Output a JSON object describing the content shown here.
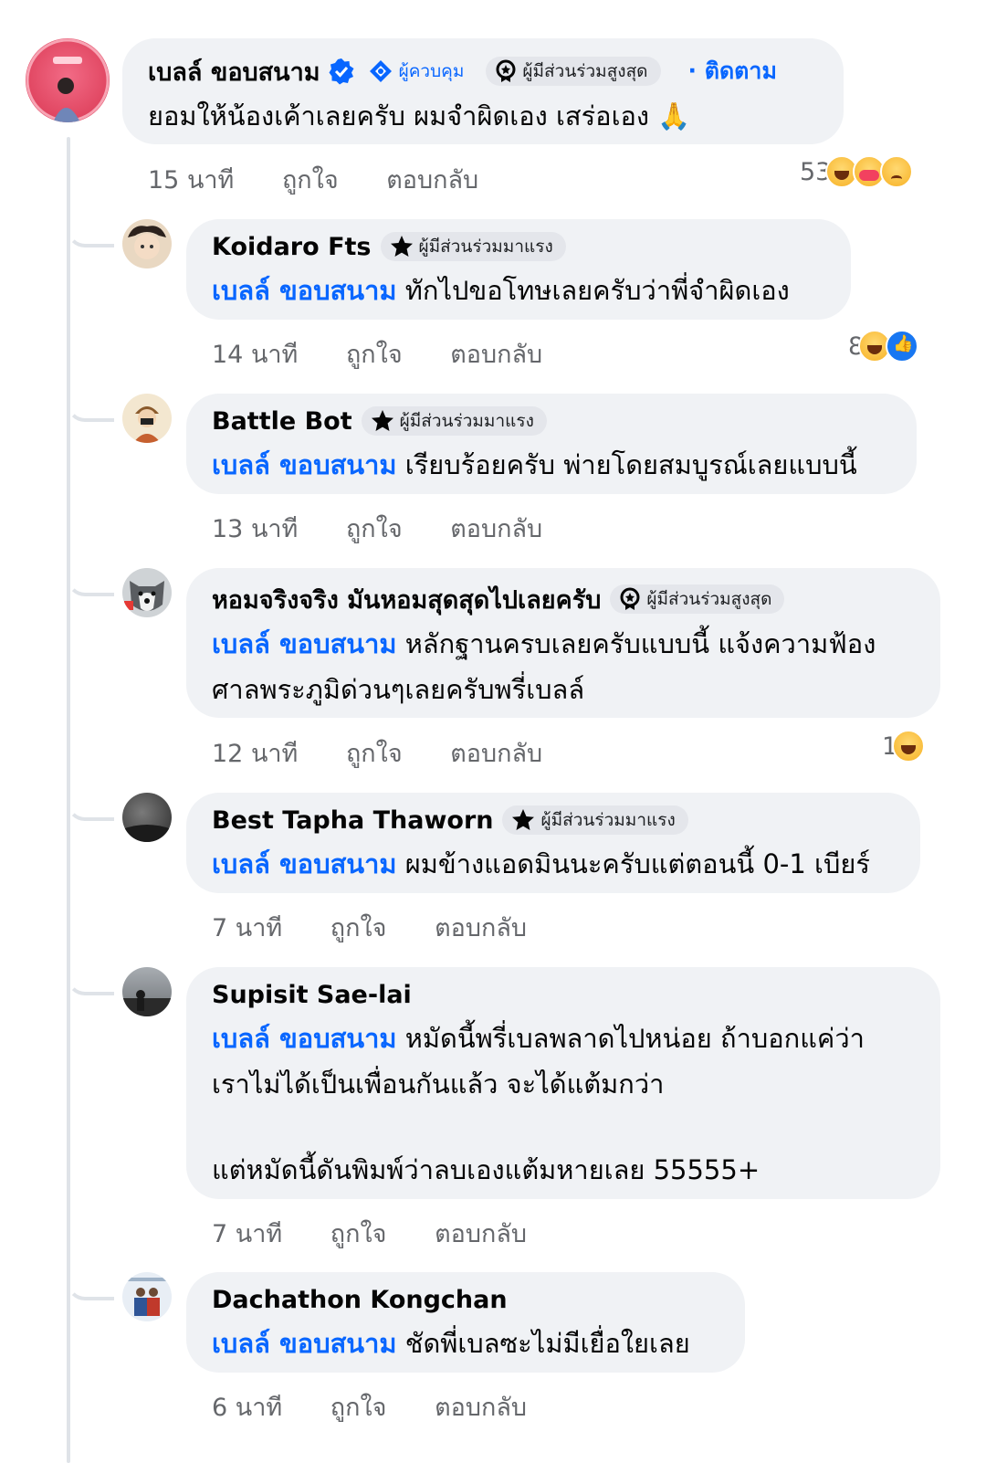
{
  "main_comment": {
    "author": "เบลล์ ขอบสนาม",
    "badge_admin": "ผู้ควบคุม",
    "badge_top": "ผู้มีส่วนร่วมสูงสุด",
    "follow": "· ติดตาม",
    "text": "ยอมให้น้องเค้าเลยครับ ผมจำผิดเอง เสร่อเอง",
    "emoji": "🙏",
    "time": "15 นาที",
    "like": "ถูกใจ",
    "reply": "ตอบกลับ",
    "reaction_count": "53",
    "reaction_icons": [
      "haha-icon",
      "care-icon",
      "sad-icon"
    ]
  },
  "replies": [
    {
      "author": "Koidaro Fts",
      "badge": "ผู้มีส่วนร่วมมาแรง",
      "badge_type": "rising",
      "mention": "เบลล์ ขอบสนาม",
      "lines": [
        "ทักไปขอโทษเลยครับว่าพี่จำผิดเอง"
      ],
      "time": "14 นาที",
      "like": "ถูกใจ",
      "reply": "ตอบกลับ",
      "reaction_count": "8",
      "reaction_icons": [
        "haha-icon",
        "like-icon"
      ]
    },
    {
      "author": "Battle Bot",
      "badge": "ผู้มีส่วนร่วมมาแรง",
      "badge_type": "rising",
      "mention": "เบลล์ ขอบสนาม",
      "lines": [
        "เรียบร้อยครับ พ่ายโดยสมบูรณ์เลยแบบนี้"
      ],
      "time": "13 นาที",
      "like": "ถูกใจ",
      "reply": "ตอบกลับ",
      "reaction_count": "",
      "reaction_icons": []
    },
    {
      "author": "หอมจริงจริง มันหอมสุดสุดไปเลยครับ",
      "badge": "ผู้มีส่วนร่วมสูงสุด",
      "badge_type": "top",
      "mention": "เบลล์ ขอบสนาม",
      "lines": [
        "หลักฐานครบเลยครับแบบนี้ แจ้งความฟ้อง",
        "ศาลพระภูมิด่วนๆเลยครับพรี่เบลล์"
      ],
      "time": "12 นาที",
      "like": "ถูกใจ",
      "reply": "ตอบกลับ",
      "reaction_count": "1",
      "reaction_icons": [
        "haha-icon"
      ]
    },
    {
      "author": "Best Tapha Thaworn",
      "badge": "ผู้มีส่วนร่วมมาแรง",
      "badge_type": "rising",
      "mention": "เบลล์ ขอบสนาม",
      "lines": [
        "ผมข้างแอดมินนะครับแต่ตอนนี้  0-1 เบียร์"
      ],
      "time": "7 นาที",
      "like": "ถูกใจ",
      "reply": "ตอบกลับ",
      "reaction_count": "",
      "reaction_icons": []
    },
    {
      "author": "Supisit Sae-lai",
      "badge": "",
      "badge_type": "",
      "mention": "เบลล์ ขอบสนาม",
      "lines": [
        "หมัดนี้พรี่เบลพลาดไปหน่อย ถ้าบอกแค่ว่า",
        "เราไม่ได้เป็นเพื่อนกันแล้ว จะได้แต้มกว่า",
        "",
        "แต่หมัดนี้ดันพิมพ์ว่าลบเองแต้มหายเลย 55555+"
      ],
      "time": "7 นาที",
      "like": "ถูกใจ",
      "reply": "ตอบกลับ",
      "reaction_count": "",
      "reaction_icons": []
    },
    {
      "author": "Dachathon Kongchan",
      "badge": "",
      "badge_type": "",
      "mention": "เบลล์ ขอบสนาม",
      "lines": [
        "ชัดพี่เบลซะไม่มีเยื่อใยเลย"
      ],
      "time": "6 นาที",
      "like": "ถูกใจ",
      "reply": "ตอบกลับ",
      "reaction_count": "",
      "reaction_icons": []
    }
  ]
}
